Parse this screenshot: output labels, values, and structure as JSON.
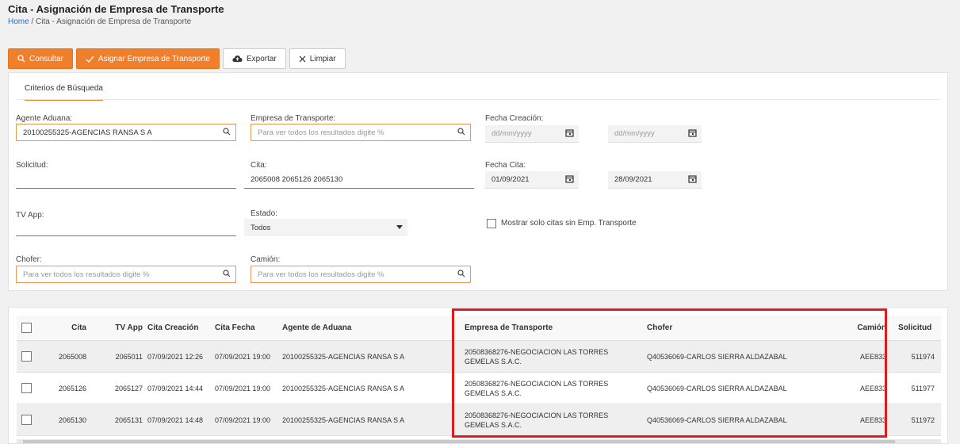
{
  "header": {
    "title": "Cita - Asignación de Empresa de Transporte",
    "breadcrumb_home": "Home",
    "breadcrumb_sep": " / ",
    "breadcrumb_current": "Cita - Asignación de Empresa de Transporte"
  },
  "toolbar": {
    "consultar": "Consultar",
    "asignar": "Asignar Empresa de Transporte",
    "exportar": "Exportar",
    "limpiar": "Limpiar"
  },
  "criteria": {
    "tab_label": "Criterios de Búsqueda",
    "agente_aduana": {
      "label": "Agente Aduana:",
      "value": "20100255325-AGENCIAS RANSA S A"
    },
    "empresa_transporte": {
      "label": "Empresa de Transporte:",
      "placeholder": "Para ver todos los resultados digite %"
    },
    "fecha_creacion": {
      "label": "Fecha Creación:",
      "from": "dd/mm/yyyy",
      "to": "dd/mm/yyyy"
    },
    "solicitud": {
      "label": "Solicitud:",
      "value": ""
    },
    "cita": {
      "label": "Cita:",
      "value": "2065008 2065126 2065130"
    },
    "fecha_cita": {
      "label": "Fecha Cita:",
      "from": "01/09/2021",
      "to": "28/09/2021"
    },
    "tv_app": {
      "label": "TV App:",
      "value": ""
    },
    "estado": {
      "label": "Estado:",
      "value": "Todos"
    },
    "mostrar_solo": {
      "label": "Mostrar solo citas sin Emp. Transporte",
      "checked": false
    },
    "chofer": {
      "label": "Chofer:",
      "placeholder": "Para ver todos los resultados digite %"
    },
    "camion": {
      "label": "Camión:",
      "placeholder": "Para ver todos los resultados digite %"
    }
  },
  "table": {
    "headers": {
      "cita": "Cita",
      "tv_app": "TV App",
      "cita_creacion": "Cita Creación",
      "cita_fecha": "Cita Fecha",
      "agente": "Agente de Aduana",
      "empresa": "Empresa de Transporte",
      "chofer": "Chofer",
      "camion": "Camión",
      "solicitud": "Solicitud"
    },
    "rows": [
      {
        "cita": "2065008",
        "tv_app": "2065011",
        "creacion": "07/09/2021 12:26",
        "fecha": "07/09/2021 19:00",
        "agente": "20100255325-AGENCIAS RANSA S A",
        "empresa": "20508368276-NEGOCIACION LAS TORRES GEMELAS S.A.C.",
        "chofer": "Q40536069-CARLOS SIERRA ALDAZABAL",
        "camion": "AEE833",
        "solicitud": "511974"
      },
      {
        "cita": "2065126",
        "tv_app": "2065127",
        "creacion": "07/09/2021 14:44",
        "fecha": "07/09/2021 19:00",
        "agente": "20100255325-AGENCIAS RANSA S A",
        "empresa": "20508368276-NEGOCIACION LAS TORRES GEMELAS S.A.C.",
        "chofer": "Q40536069-CARLOS SIERRA ALDAZABAL",
        "camion": "AEE833",
        "solicitud": "511977"
      },
      {
        "cita": "2065130",
        "tv_app": "2065131",
        "creacion": "07/09/2021 14:48",
        "fecha": "07/09/2021 19:00",
        "agente": "20100255325-AGENCIAS RANSA S A",
        "empresa": "20508368276-NEGOCIACION LAS TORRES GEMELAS S.A.C.",
        "chofer": "Q40536069-CARLOS SIERRA ALDAZABAL",
        "camion": "AEE833",
        "solicitud": "511972"
      }
    ]
  },
  "colors": {
    "accent": "#f07f2c",
    "highlight": "#e01b1b",
    "link": "#1f6fd1"
  }
}
